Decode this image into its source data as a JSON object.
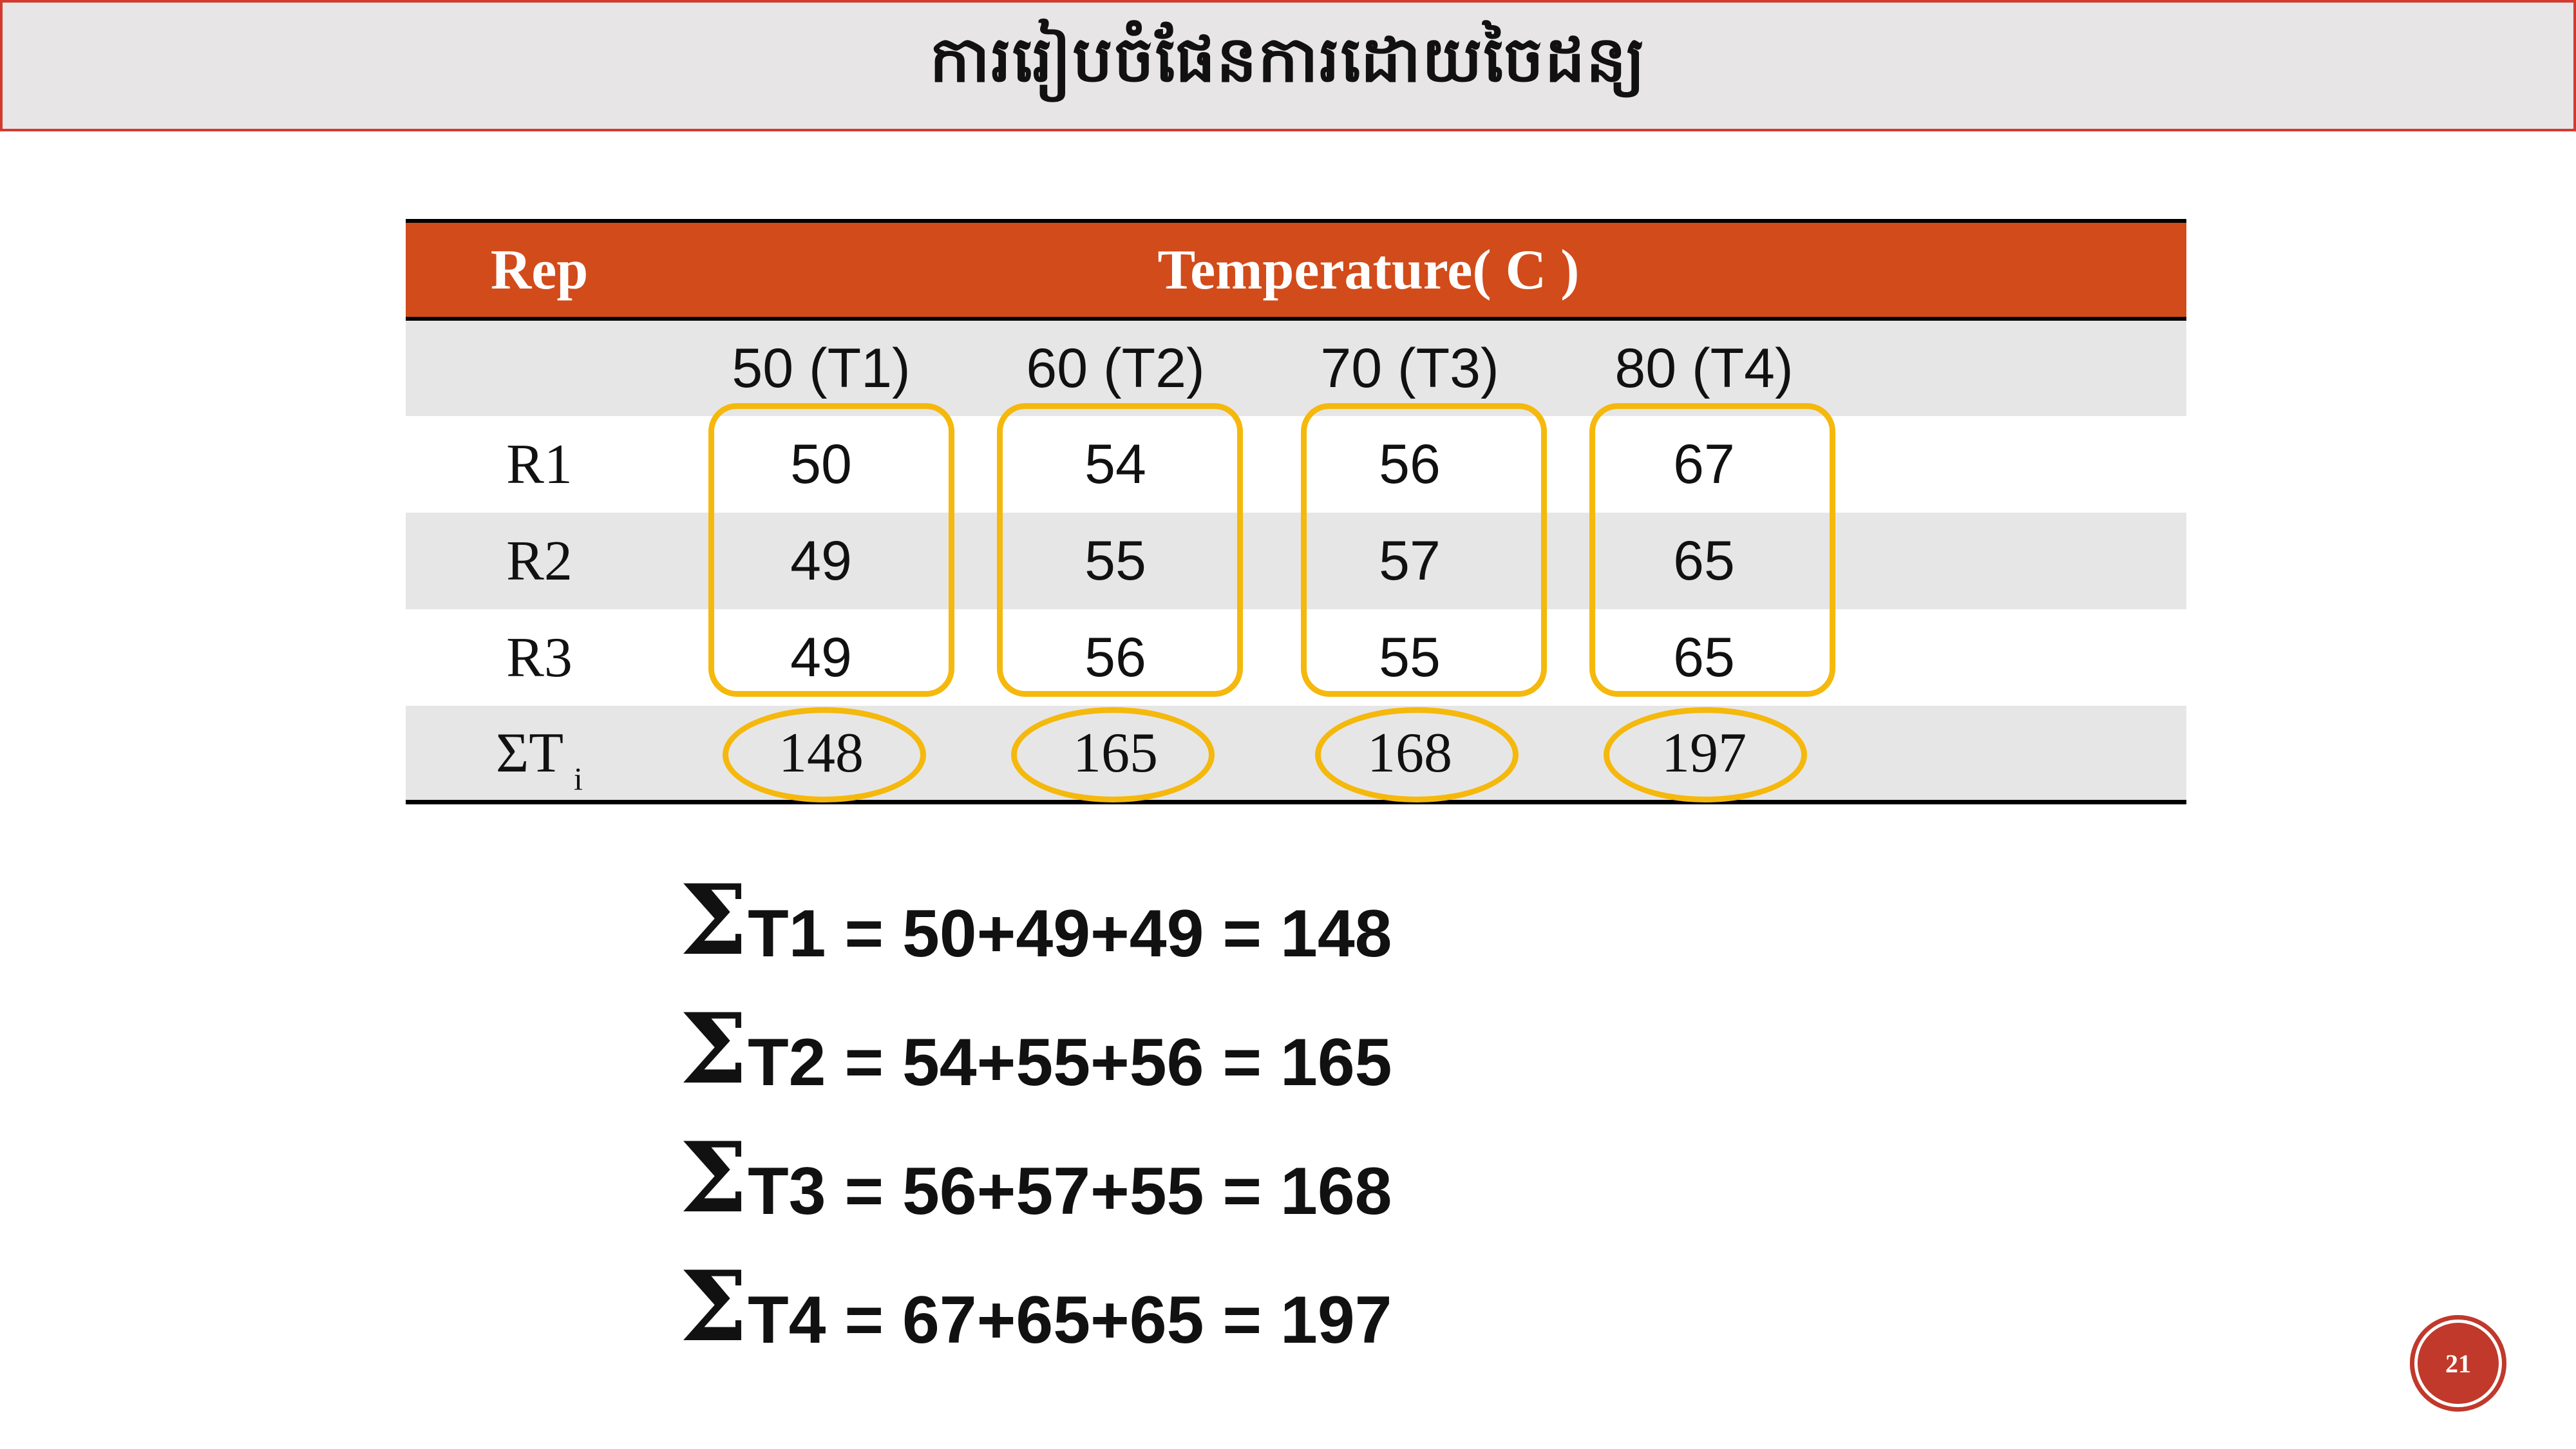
{
  "title": "ការរៀបចំផែនការដោយចៃដន្យ",
  "table": {
    "rep_header": "Rep",
    "temp_header": "Temperature( C )",
    "treatments": [
      "50 (T1)",
      "60 (T2)",
      "70 (T3)",
      "80 (T4)"
    ],
    "rows": [
      {
        "label": "R1",
        "values": [
          "50",
          "54",
          "56",
          "67"
        ]
      },
      {
        "label": "R2",
        "values": [
          "49",
          "55",
          "57",
          "65"
        ]
      },
      {
        "label": "R3",
        "values": [
          "49",
          "56",
          "55",
          "65"
        ]
      }
    ],
    "total_row": {
      "label_symbol": "ΣT",
      "label_sub": "i",
      "values": [
        "148",
        "165",
        "168",
        "197"
      ]
    }
  },
  "equations": [
    {
      "sigma": "Σ",
      "text": "T1 = 50+49+49 = 148"
    },
    {
      "sigma": "Σ",
      "text": "T2 = 54+55+56 = 165"
    },
    {
      "sigma": "Σ",
      "text": "T3 = 56+57+55 = 168"
    },
    {
      "sigma": "Σ",
      "text": "T4 = 67+65+65 = 197"
    }
  ],
  "page_number": "21",
  "colors": {
    "title_bg": "#e7e5e6",
    "title_border": "#d33a2f",
    "header_bg": "#d24b1a",
    "shade_bg": "#e7e6e6",
    "highlight": "#f5b80c",
    "badge": "#c0392b"
  }
}
